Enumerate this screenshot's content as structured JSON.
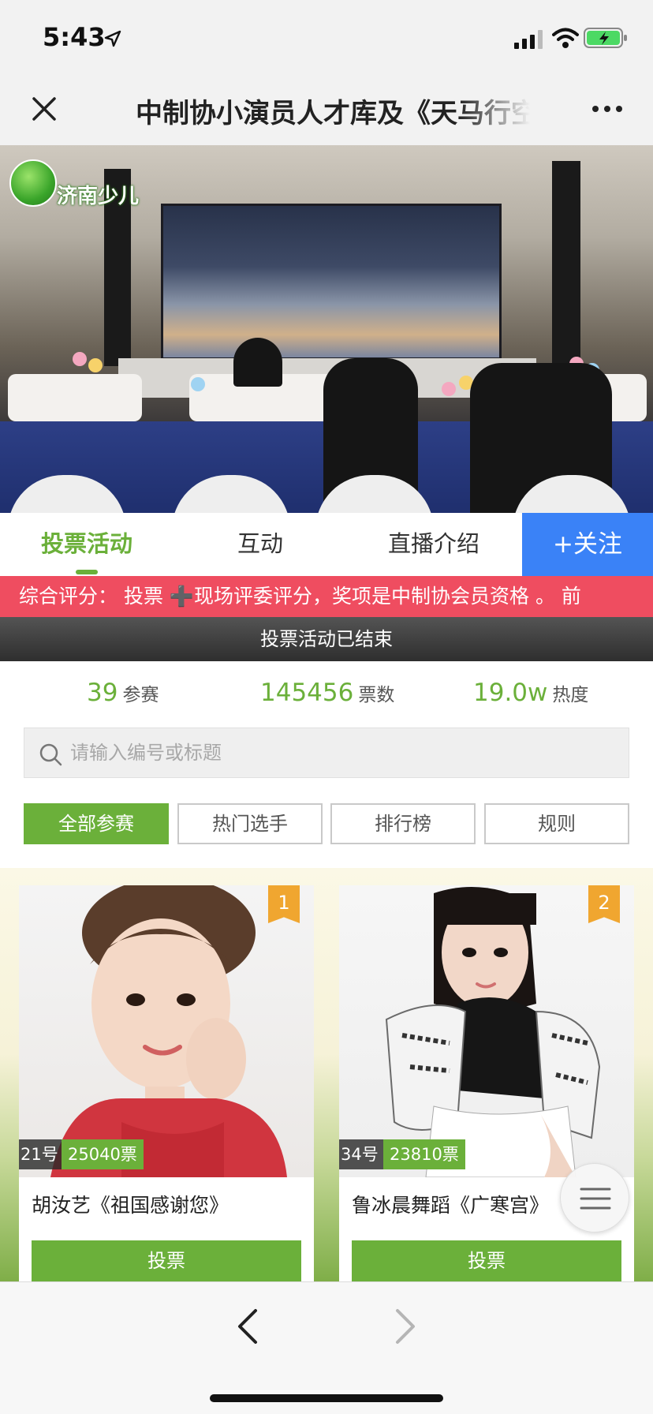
{
  "status_bar": {
    "time": "5:43"
  },
  "nav": {
    "title": "中制协小演员人才库及《天马行空》"
  },
  "hero": {
    "logo_text": "济南少儿"
  },
  "tabs": [
    {
      "label": "投票活动",
      "active": true
    },
    {
      "label": "互动",
      "active": false
    },
    {
      "label": "直播介绍",
      "active": false
    }
  ],
  "follow_label": "+关注",
  "marquee_text": "综合评分： 投票 ➕现场评委评分，奖项是中制协会员资格 。 前",
  "ended_text": "投票活动已结束",
  "stats": [
    {
      "value": "39",
      "label": "参赛"
    },
    {
      "value": "145456",
      "label": "票数"
    },
    {
      "value": "19.0w",
      "label": "热度"
    }
  ],
  "search": {
    "placeholder": "请输入编号或标题"
  },
  "filters": [
    {
      "label": "全部参赛",
      "active": true
    },
    {
      "label": "热门选手",
      "active": false
    },
    {
      "label": "排行榜",
      "active": false
    },
    {
      "label": "规则",
      "active": false
    }
  ],
  "contestants": [
    {
      "rank": "1",
      "number": "21号",
      "votes": "25040票",
      "title": "胡汝艺《祖国感谢您》",
      "vote_label": "投票"
    },
    {
      "rank": "2",
      "number": "34号",
      "votes": "23810票",
      "title": "鲁冰晨舞蹈《广寒宫》",
      "vote_label": "投票"
    }
  ],
  "colors": {
    "accent_green": "#6bb03a",
    "follow_blue": "#3a82f7",
    "marquee_red": "#ef4d60",
    "rank_orange": "#f0a630"
  }
}
